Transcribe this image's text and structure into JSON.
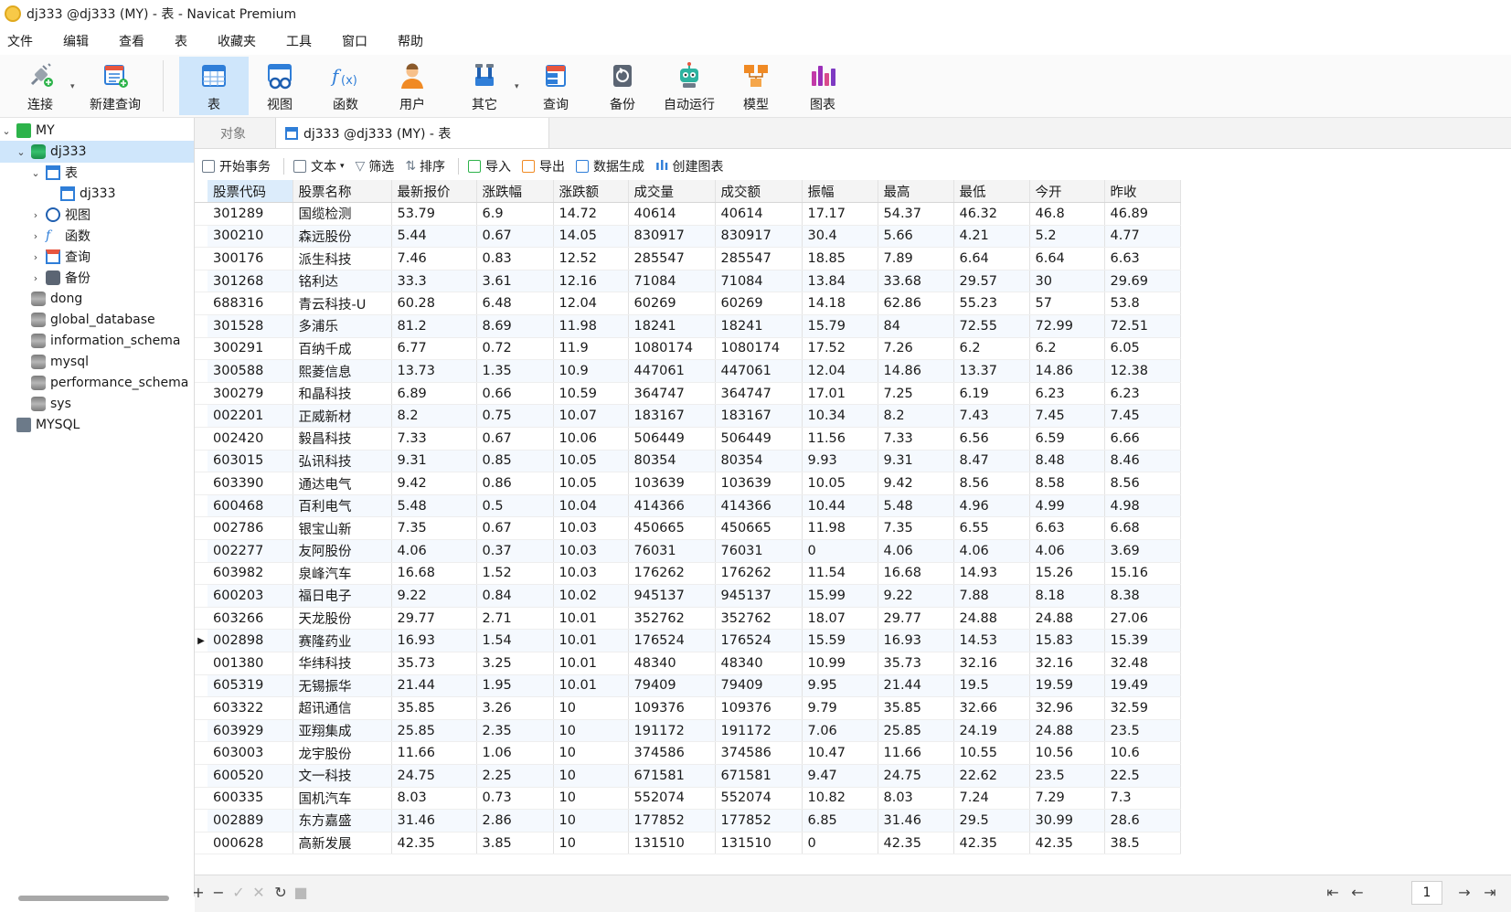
{
  "window": {
    "title": "dj333 @dj333 (MY) - 表 - Navicat Premium"
  },
  "menu": [
    "文件",
    "编辑",
    "查看",
    "表",
    "收藏夹",
    "工具",
    "窗口",
    "帮助"
  ],
  "toolbar": {
    "connect": "连接",
    "new_query": "新建查询",
    "table": "表",
    "view": "视图",
    "function": "函数",
    "user": "用户",
    "other": "其它",
    "query": "查询",
    "backup": "备份",
    "automation": "自动运行",
    "model": "模型",
    "chart": "图表"
  },
  "sidebar": {
    "items": [
      {
        "label": "MY"
      },
      {
        "label": "dj333"
      },
      {
        "label": "表"
      },
      {
        "label": "dj333"
      },
      {
        "label": "视图"
      },
      {
        "label": "函数"
      },
      {
        "label": "查询"
      },
      {
        "label": "备份"
      },
      {
        "label": "dong"
      },
      {
        "label": "global_database"
      },
      {
        "label": "information_schema"
      },
      {
        "label": "mysql"
      },
      {
        "label": "performance_schema"
      },
      {
        "label": "sys"
      },
      {
        "label": "MYSQL"
      }
    ]
  },
  "tabs": {
    "objects": "对象",
    "active": "dj333 @dj333 (MY) - 表"
  },
  "grid_toolbar": {
    "begin_transaction": "开始事务",
    "text": "文本",
    "filter": "筛选",
    "sort": "排序",
    "import": "导入",
    "export": "导出",
    "data_generation": "数据生成",
    "create_chart": "创建图表"
  },
  "table": {
    "columns": [
      "股票代码",
      "股票名称",
      "最新报价",
      "涨跌幅",
      "涨跌额",
      "成交量",
      "成交额",
      "振幅",
      "最高",
      "最低",
      "今开",
      "昨收"
    ],
    "current_row": 19,
    "rows": [
      [
        "301289",
        "国缆检测",
        "53.79",
        "6.9",
        "14.72",
        "40614",
        "40614",
        "17.17",
        "54.37",
        "46.32",
        "46.8",
        "46.89"
      ],
      [
        "300210",
        "森远股份",
        "5.44",
        "0.67",
        "14.05",
        "830917",
        "830917",
        "30.4",
        "5.66",
        "4.21",
        "5.2",
        "4.77"
      ],
      [
        "300176",
        "派生科技",
        "7.46",
        "0.83",
        "12.52",
        "285547",
        "285547",
        "18.85",
        "7.89",
        "6.64",
        "6.64",
        "6.63"
      ],
      [
        "301268",
        "铭利达",
        "33.3",
        "3.61",
        "12.16",
        "71084",
        "71084",
        "13.84",
        "33.68",
        "29.57",
        "30",
        "29.69"
      ],
      [
        "688316",
        "青云科技-U",
        "60.28",
        "6.48",
        "12.04",
        "60269",
        "60269",
        "14.18",
        "62.86",
        "55.23",
        "57",
        "53.8"
      ],
      [
        "301528",
        "多浦乐",
        "81.2",
        "8.69",
        "11.98",
        "18241",
        "18241",
        "15.79",
        "84",
        "72.55",
        "72.99",
        "72.51"
      ],
      [
        "300291",
        "百纳千成",
        "6.77",
        "0.72",
        "11.9",
        "1080174",
        "1080174",
        "17.52",
        "7.26",
        "6.2",
        "6.2",
        "6.05"
      ],
      [
        "300588",
        "熙菱信息",
        "13.73",
        "1.35",
        "10.9",
        "447061",
        "447061",
        "12.04",
        "14.86",
        "13.37",
        "14.86",
        "12.38"
      ],
      [
        "300279",
        "和晶科技",
        "6.89",
        "0.66",
        "10.59",
        "364747",
        "364747",
        "17.01",
        "7.25",
        "6.19",
        "6.23",
        "6.23"
      ],
      [
        "002201",
        "正威新材",
        "8.2",
        "0.75",
        "10.07",
        "183167",
        "183167",
        "10.34",
        "8.2",
        "7.43",
        "7.45",
        "7.45"
      ],
      [
        "002420",
        "毅昌科技",
        "7.33",
        "0.67",
        "10.06",
        "506449",
        "506449",
        "11.56",
        "7.33",
        "6.56",
        "6.59",
        "6.66"
      ],
      [
        "603015",
        "弘讯科技",
        "9.31",
        "0.85",
        "10.05",
        "80354",
        "80354",
        "9.93",
        "9.31",
        "8.47",
        "8.48",
        "8.46"
      ],
      [
        "603390",
        "通达电气",
        "9.42",
        "0.86",
        "10.05",
        "103639",
        "103639",
        "10.05",
        "9.42",
        "8.56",
        "8.58",
        "8.56"
      ],
      [
        "600468",
        "百利电气",
        "5.48",
        "0.5",
        "10.04",
        "414366",
        "414366",
        "10.44",
        "5.48",
        "4.96",
        "4.99",
        "4.98"
      ],
      [
        "002786",
        "银宝山新",
        "7.35",
        "0.67",
        "10.03",
        "450665",
        "450665",
        "11.98",
        "7.35",
        "6.55",
        "6.63",
        "6.68"
      ],
      [
        "002277",
        "友阿股份",
        "4.06",
        "0.37",
        "10.03",
        "76031",
        "76031",
        "0",
        "4.06",
        "4.06",
        "4.06",
        "3.69"
      ],
      [
        "603982",
        "泉峰汽车",
        "16.68",
        "1.52",
        "10.03",
        "176262",
        "176262",
        "11.54",
        "16.68",
        "14.93",
        "15.26",
        "15.16"
      ],
      [
        "600203",
        "福日电子",
        "9.22",
        "0.84",
        "10.02",
        "945137",
        "945137",
        "15.99",
        "9.22",
        "7.88",
        "8.18",
        "8.38"
      ],
      [
        "603266",
        "天龙股份",
        "29.77",
        "2.71",
        "10.01",
        "352762",
        "352762",
        "18.07",
        "29.77",
        "24.88",
        "24.88",
        "27.06"
      ],
      [
        "002898",
        "赛隆药业",
        "16.93",
        "1.54",
        "10.01",
        "176524",
        "176524",
        "15.59",
        "16.93",
        "14.53",
        "15.83",
        "15.39"
      ],
      [
        "001380",
        "华纬科技",
        "35.73",
        "3.25",
        "10.01",
        "48340",
        "48340",
        "10.99",
        "35.73",
        "32.16",
        "32.16",
        "32.48"
      ],
      [
        "605319",
        "无锡振华",
        "21.44",
        "1.95",
        "10.01",
        "79409",
        "79409",
        "9.95",
        "21.44",
        "19.5",
        "19.59",
        "19.49"
      ],
      [
        "603322",
        "超讯通信",
        "35.85",
        "3.26",
        "10",
        "109376",
        "109376",
        "9.79",
        "35.85",
        "32.66",
        "32.96",
        "32.59"
      ],
      [
        "603929",
        "亚翔集成",
        "25.85",
        "2.35",
        "10",
        "191172",
        "191172",
        "7.06",
        "25.85",
        "24.19",
        "24.88",
        "23.5"
      ],
      [
        "603003",
        "龙宇股份",
        "11.66",
        "1.06",
        "10",
        "374586",
        "374586",
        "10.47",
        "11.66",
        "10.55",
        "10.56",
        "10.6"
      ],
      [
        "600520",
        "文一科技",
        "24.75",
        "2.25",
        "10",
        "671581",
        "671581",
        "9.47",
        "24.75",
        "22.62",
        "23.5",
        "22.5"
      ],
      [
        "600335",
        "国机汽车",
        "8.03",
        "0.73",
        "10",
        "552074",
        "552074",
        "10.82",
        "8.03",
        "7.24",
        "7.29",
        "7.3"
      ],
      [
        "002889",
        "东方嘉盛",
        "31.46",
        "2.86",
        "10",
        "177852",
        "177852",
        "6.85",
        "31.46",
        "29.5",
        "30.99",
        "28.6"
      ],
      [
        "000628",
        "高新发展",
        "42.35",
        "3.85",
        "10",
        "131510",
        "131510",
        "0",
        "42.35",
        "42.35",
        "42.35",
        "38.5"
      ]
    ]
  },
  "statusbar": {
    "page": "1"
  },
  "colors": {
    "accent": "#2f7ed8",
    "selection": "#cfe6fb",
    "row_alt": "#f5f9fe"
  }
}
